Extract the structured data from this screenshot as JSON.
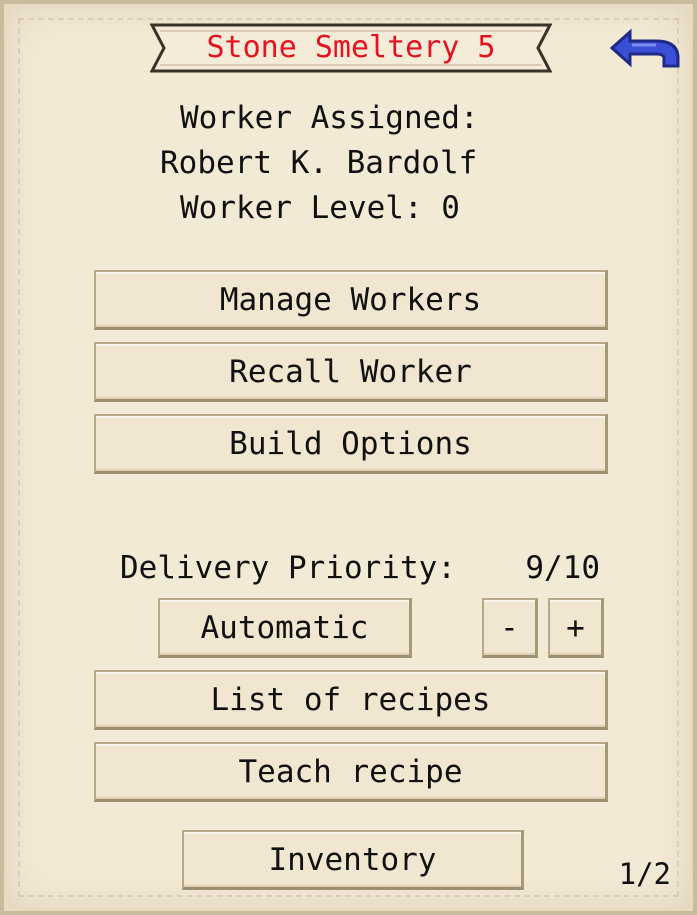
{
  "title": "Stone Smeltery 5",
  "worker": {
    "assigned_label": "Worker Assigned:",
    "name": "Robert K. Bardolf",
    "level_label": "Worker Level: 0"
  },
  "buttons": {
    "manage_workers": "Manage Workers",
    "recall_worker": "Recall Worker",
    "build_options": "Build Options",
    "automatic": "Automatic",
    "minus": "-",
    "plus": "+",
    "list_of_recipes": "List of recipes",
    "teach_recipe": "Teach recipe",
    "inventory": "Inventory"
  },
  "priority": {
    "label": "Delivery Priority:",
    "value": "9/10"
  },
  "page_indicator": "1/2",
  "icons": {
    "back": "back-arrow-icon"
  },
  "colors": {
    "title": "#e8111e",
    "arrow": "#3b4fd6",
    "panel": "#f3ead6"
  }
}
